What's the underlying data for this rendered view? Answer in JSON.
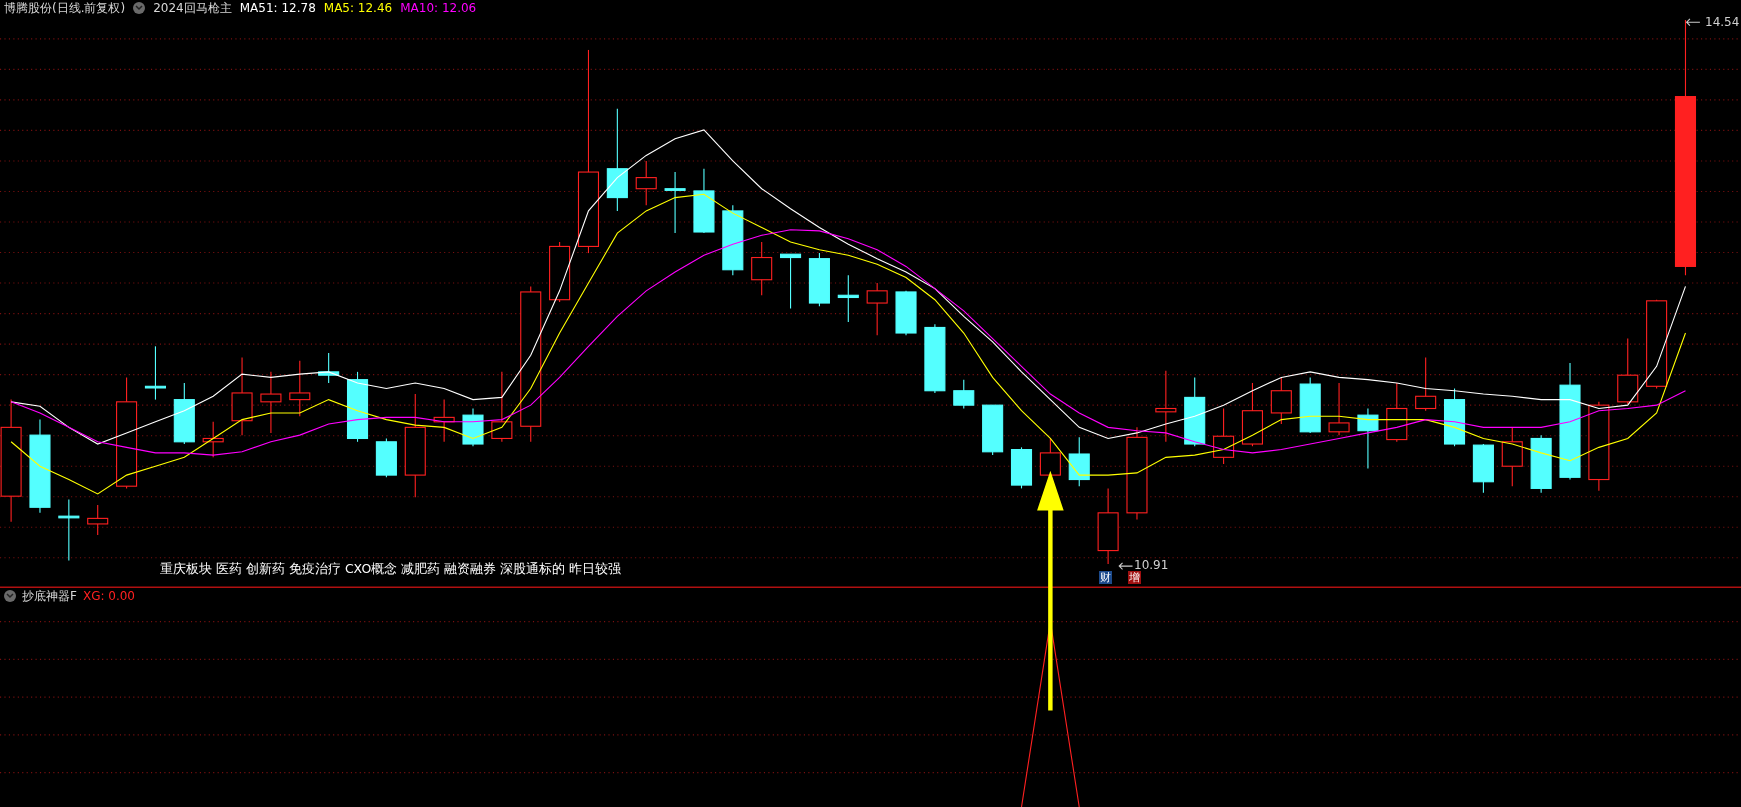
{
  "main_panel": {
    "title": "博腾股份(日线.前复权)",
    "formula": "2024回马枪主",
    "indicators": [
      {
        "label": "MA51: 12.78",
        "color": "#ffffff"
      },
      {
        "label": "MA5: 12.46",
        "color": "#ffff00"
      },
      {
        "label": "MA10: 12.06",
        "color": "#ff00ff"
      }
    ],
    "high_label": "14.54",
    "low_label": "10.91",
    "concepts": "重庆板块 医药 创新药 免疫治疗 CXO概念 减肥药 融资融券 深股通标的 昨日较强",
    "badges": [
      {
        "label": "财",
        "color": "#1c4a8c"
      },
      {
        "label": "增",
        "color": "#a01010"
      }
    ]
  },
  "sub_panel": {
    "title": "抄底神器F",
    "reading": "XG: 0.00"
  }
}
